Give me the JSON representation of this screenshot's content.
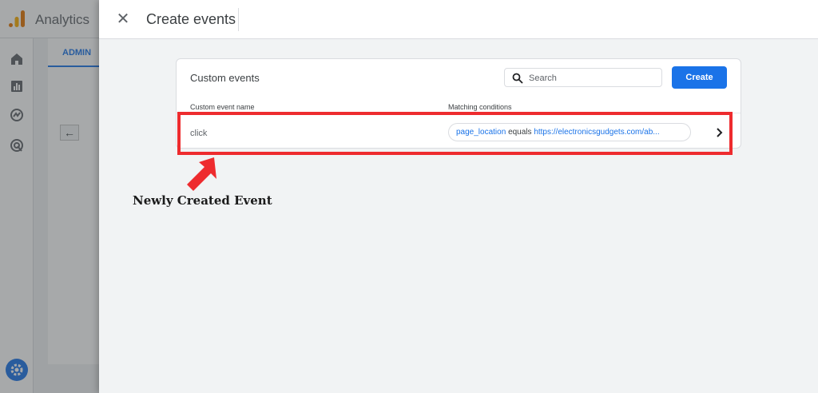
{
  "app": {
    "title": "Analytics",
    "admin_tab": "ADMIN"
  },
  "sheet": {
    "title": "Create events"
  },
  "custom_events": {
    "title": "Custom events",
    "search_placeholder": "Search",
    "create_label": "Create",
    "columns": [
      "Custom event name",
      "Matching conditions"
    ],
    "rows": [
      {
        "name": "click",
        "condition": {
          "parameter": "page_location",
          "operator": "equals",
          "value": "https://electronicsgudgets.com/ab..."
        }
      }
    ]
  },
  "annotation": {
    "label": "Newly Created Event",
    "color": "#ee2b2e"
  },
  "colors": {
    "accent": "#1a73e8",
    "highlight": "#ee2b2e"
  },
  "icons": [
    "analytics-logo-icon",
    "home-icon",
    "reports-icon",
    "explore-icon",
    "advertising-icon",
    "settings-icon",
    "close-icon",
    "search-icon",
    "chevron-right-icon",
    "back-arrow-icon"
  ]
}
